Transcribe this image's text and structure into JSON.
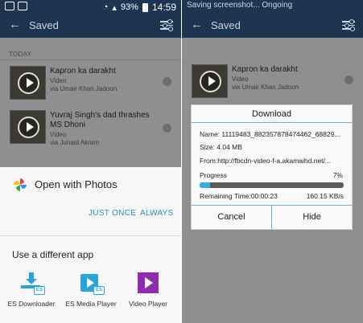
{
  "left": {
    "status": {
      "battery": "93%",
      "time": "14:59"
    },
    "appbar": {
      "title": "Saved"
    },
    "section": "TODAY",
    "items": [
      {
        "title": "Kapron ka darakht",
        "type": "Video",
        "via": "via Umair Khan Jadoon"
      },
      {
        "title": "Yuvraj Singh's dad thrashes MS Dhoni",
        "type": "Video",
        "via": "via Junaid Akram"
      }
    ],
    "sheet": {
      "open_with": "Open with Photos",
      "just_once": "JUST ONCE",
      "always": "ALWAYS",
      "different_app": "Use a different app",
      "apps": [
        {
          "label": "ES Downloader",
          "icon": "es-downloader-icon"
        },
        {
          "label": "ES Media Player",
          "icon": "es-media-player-icon"
        },
        {
          "label": "Video Player",
          "icon": "video-player-icon"
        }
      ]
    }
  },
  "right": {
    "status": {
      "notification": "Saving screenshot... Ongoing"
    },
    "appbar": {
      "title": "Saved"
    },
    "item": {
      "title": "Kapron ka darakht",
      "type": "Video",
      "via": "via Umair Khan Jadoon"
    },
    "dialog": {
      "title": "Download",
      "name": "Name: 11119483_882357878474462_68829...",
      "size": "Size: 4.04 MB",
      "from": "From:http://fbcdn-video-f-a.akamaihd.net/...",
      "progress_label": "Progress",
      "progress_pct": "7%",
      "progress": 0.07,
      "remaining": "Remaining Time:00:00:23",
      "speed": "160.15 KB/s",
      "cancel": "Cancel",
      "hide": "Hide"
    }
  },
  "colors": {
    "appbar": "#1e3551",
    "accent": "#2a8fb5",
    "progress": "#36aee2"
  }
}
